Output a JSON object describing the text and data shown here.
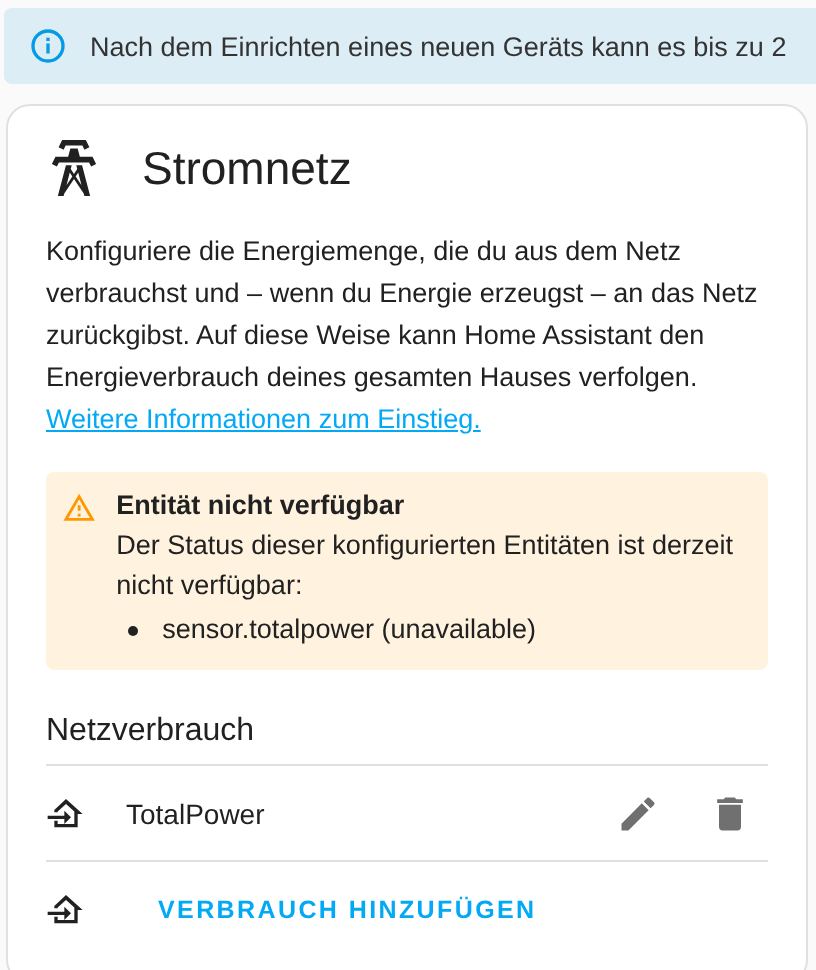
{
  "banner": {
    "kind": "info",
    "text": "Nach dem Einrichten eines neuen Geräts kann es bis zu 2"
  },
  "card": {
    "title": "Stromnetz",
    "description": "Konfiguriere die Energiemenge, die du aus dem Netz verbrauchst und – wenn du Energie erzeugst – an das Netz zurückgibst. Auf diese Weise kann Home Assistant den Energieverbrauch deines gesamten Hauses verfolgen.",
    "link": "Weitere Informationen zum Einstieg.",
    "warning": {
      "title": "Entität nicht verfügbar",
      "message": "Der Status dieser konfigurierten Entitäten ist derzeit nicht verfügbar:",
      "items": [
        "sensor.totalpower (unavailable)"
      ]
    },
    "section": "Netzverbrauch",
    "sources": [
      {
        "name": "TotalPower"
      }
    ],
    "add_button": "VERBRAUCH HINZUFÜGEN"
  }
}
